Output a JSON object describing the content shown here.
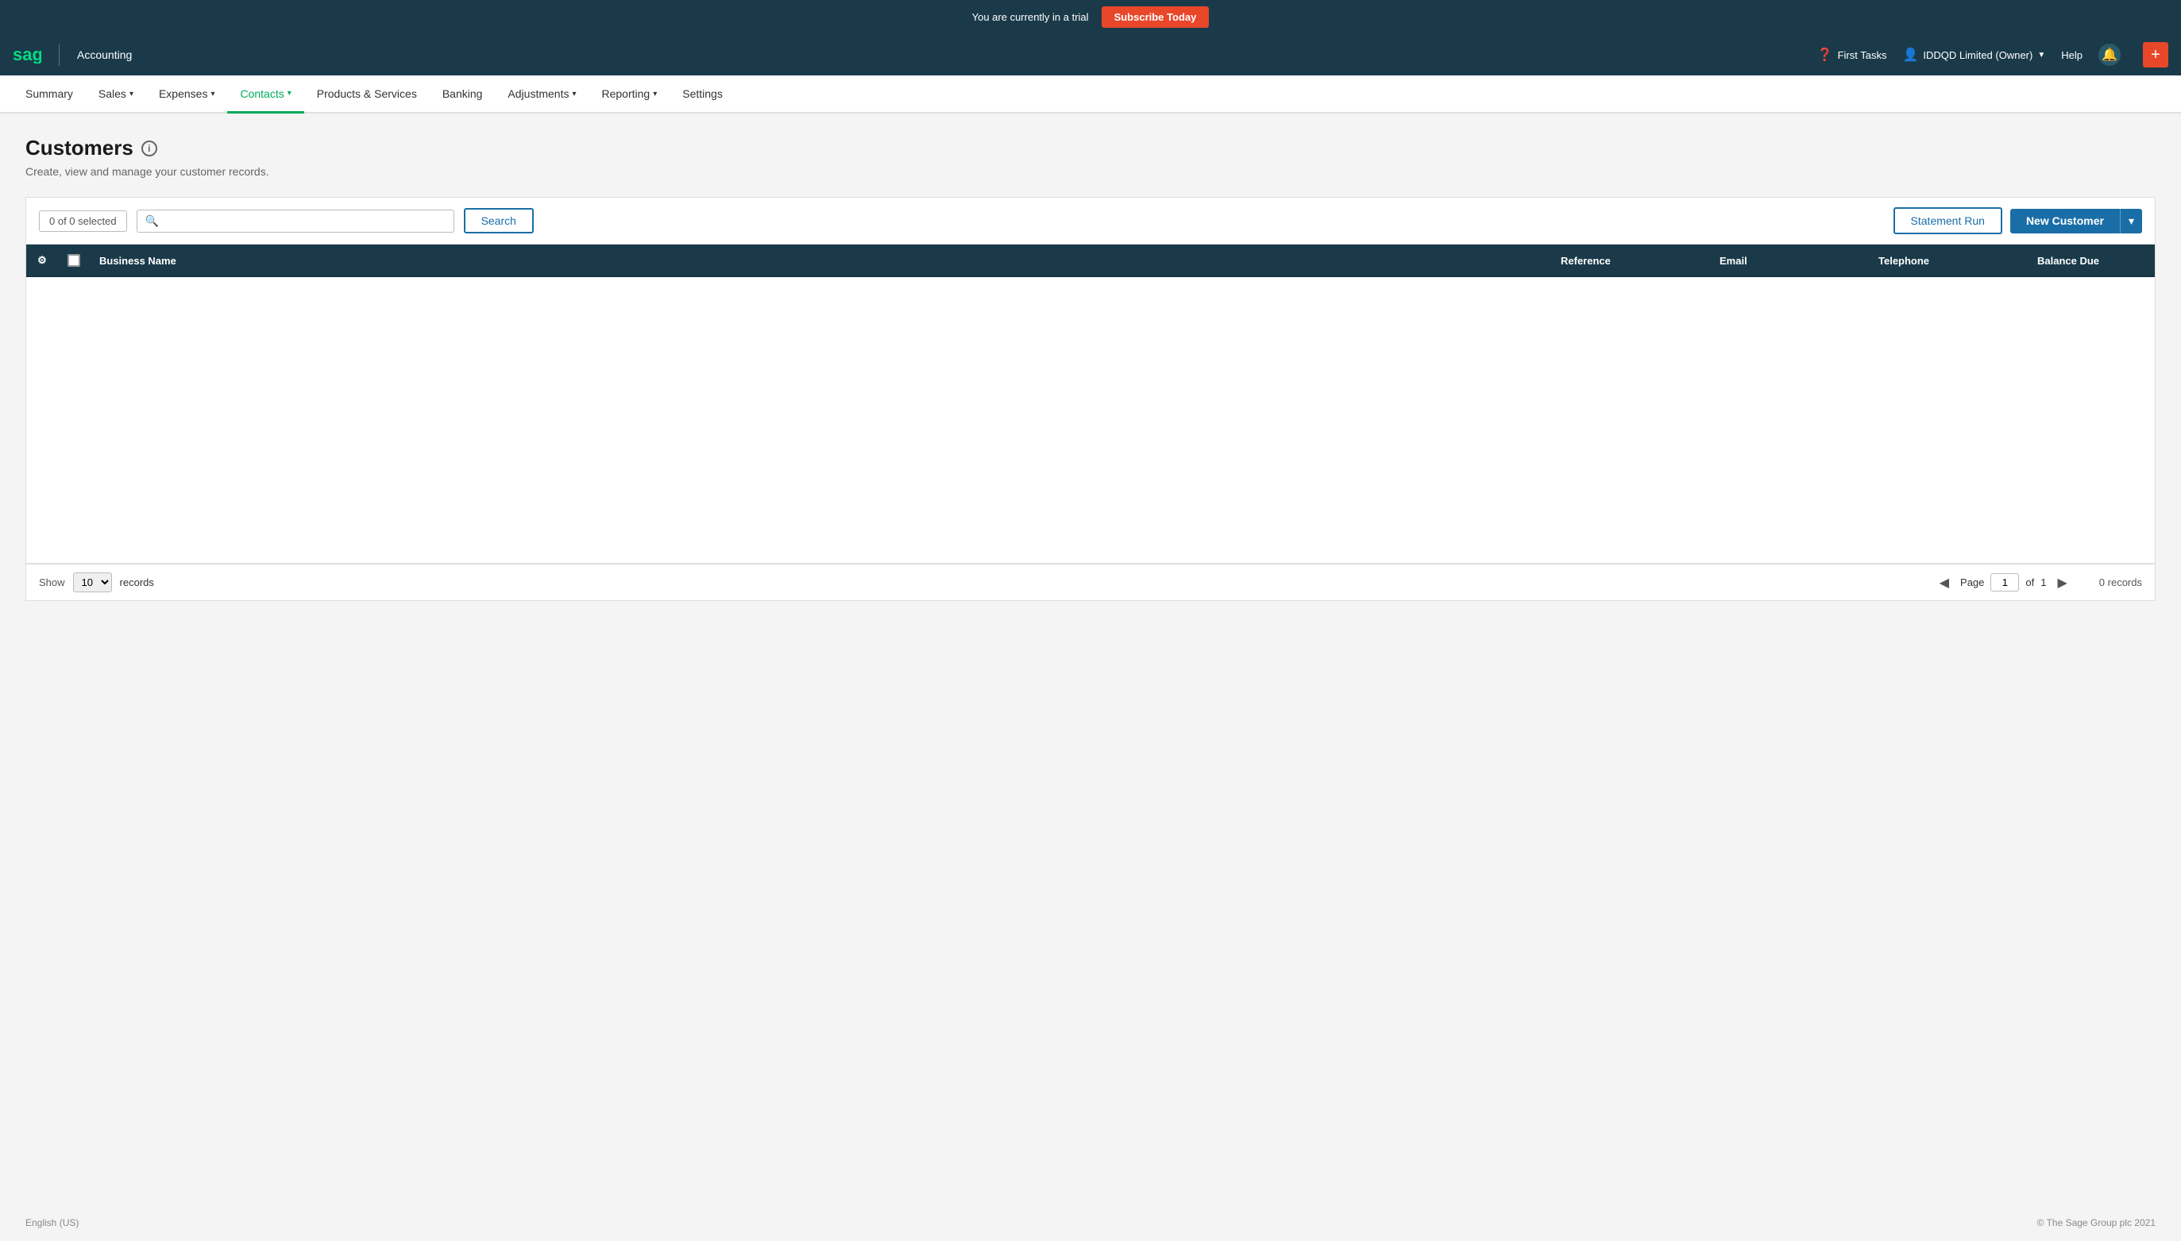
{
  "trial_banner": {
    "text": "You are currently in a trial",
    "button_label": "Subscribe Today"
  },
  "top_nav": {
    "logo": "sage",
    "app_name": "Accounting",
    "first_tasks": "First Tasks",
    "user_account": "IDDQD Limited (Owner)",
    "help": "Help"
  },
  "main_nav": {
    "items": [
      {
        "label": "Summary",
        "active": false,
        "has_arrow": false
      },
      {
        "label": "Sales",
        "active": false,
        "has_arrow": true
      },
      {
        "label": "Expenses",
        "active": false,
        "has_arrow": true
      },
      {
        "label": "Contacts",
        "active": true,
        "has_arrow": true
      },
      {
        "label": "Products & Services",
        "active": false,
        "has_arrow": false
      },
      {
        "label": "Banking",
        "active": false,
        "has_arrow": false
      },
      {
        "label": "Adjustments",
        "active": false,
        "has_arrow": true
      },
      {
        "label": "Reporting",
        "active": false,
        "has_arrow": true
      },
      {
        "label": "Settings",
        "active": false,
        "has_arrow": false
      }
    ]
  },
  "page": {
    "title": "Customers",
    "subtitle": "Create, view and manage your customer records.",
    "selected_label": "0 of 0 selected",
    "search_placeholder": "",
    "search_button": "Search",
    "statement_run_button": "Statement Run",
    "new_customer_button": "New Customer"
  },
  "table": {
    "columns": [
      {
        "label": "",
        "type": "gear"
      },
      {
        "label": "",
        "type": "checkbox"
      },
      {
        "label": "Business Name"
      },
      {
        "label": "Reference"
      },
      {
        "label": "Email"
      },
      {
        "label": "Telephone"
      },
      {
        "label": "Balance Due"
      }
    ],
    "rows": []
  },
  "pagination": {
    "show_label": "Show",
    "records_per_page": "10",
    "records_label": "records",
    "page_label": "Page",
    "current_page": "1",
    "of_label": "of",
    "total_pages": "1",
    "records_count": "0 records"
  },
  "footer": {
    "locale": "English (US)",
    "copyright": "© The Sage Group plc 2021"
  }
}
